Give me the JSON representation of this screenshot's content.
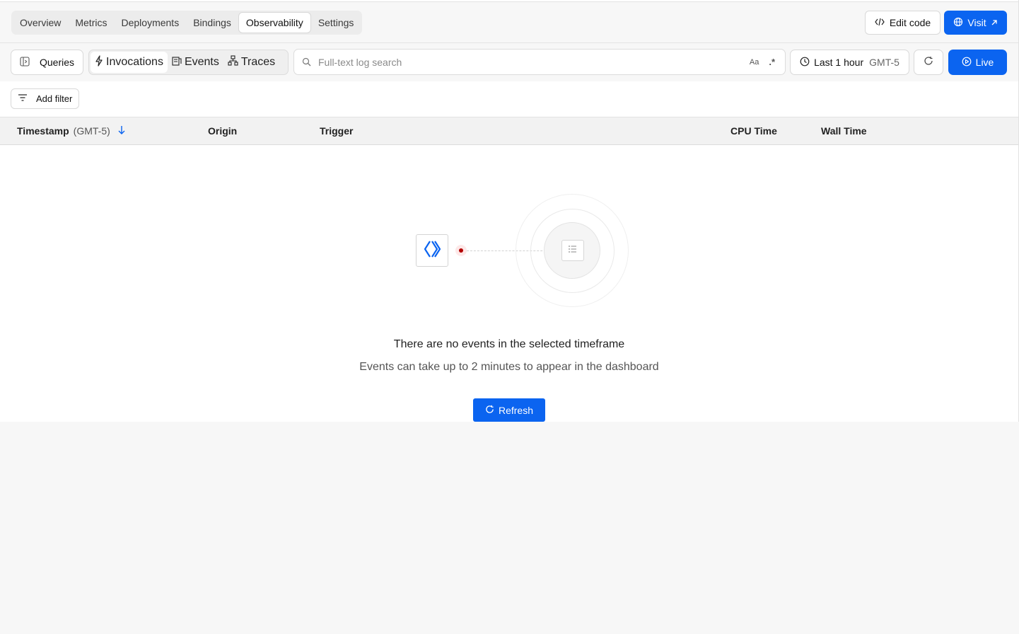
{
  "nav": {
    "tabs": [
      "Overview",
      "Metrics",
      "Deployments",
      "Bindings",
      "Observability",
      "Settings"
    ],
    "active": "Observability"
  },
  "header_actions": {
    "edit_code": "Edit code",
    "visit": "Visit"
  },
  "toolbar": {
    "queries": "Queries",
    "dataset_tabs": [
      "Invocations",
      "Events",
      "Traces"
    ],
    "active_dataset": "Invocations",
    "search_placeholder": "Full-text log search",
    "case_option": "Aa",
    "regex_option": ".*",
    "time_range": "Last 1 hour",
    "timezone": "GMT-5",
    "live": "Live"
  },
  "filter": {
    "add_filter": "Add filter"
  },
  "table": {
    "columns": {
      "timestamp": "Timestamp",
      "timestamp_tz": "(GMT-5)",
      "origin": "Origin",
      "trigger": "Trigger",
      "cpu_time": "CPU Time",
      "wall_time": "Wall Time"
    },
    "sort": "descending"
  },
  "empty_state": {
    "title": "There are no events in the selected timeframe",
    "subtitle": "Events can take up to 2 minutes to appear in the dashboard",
    "refresh": "Refresh"
  },
  "colors": {
    "accent": "#0b64f0",
    "status_dot": "#b30000"
  }
}
